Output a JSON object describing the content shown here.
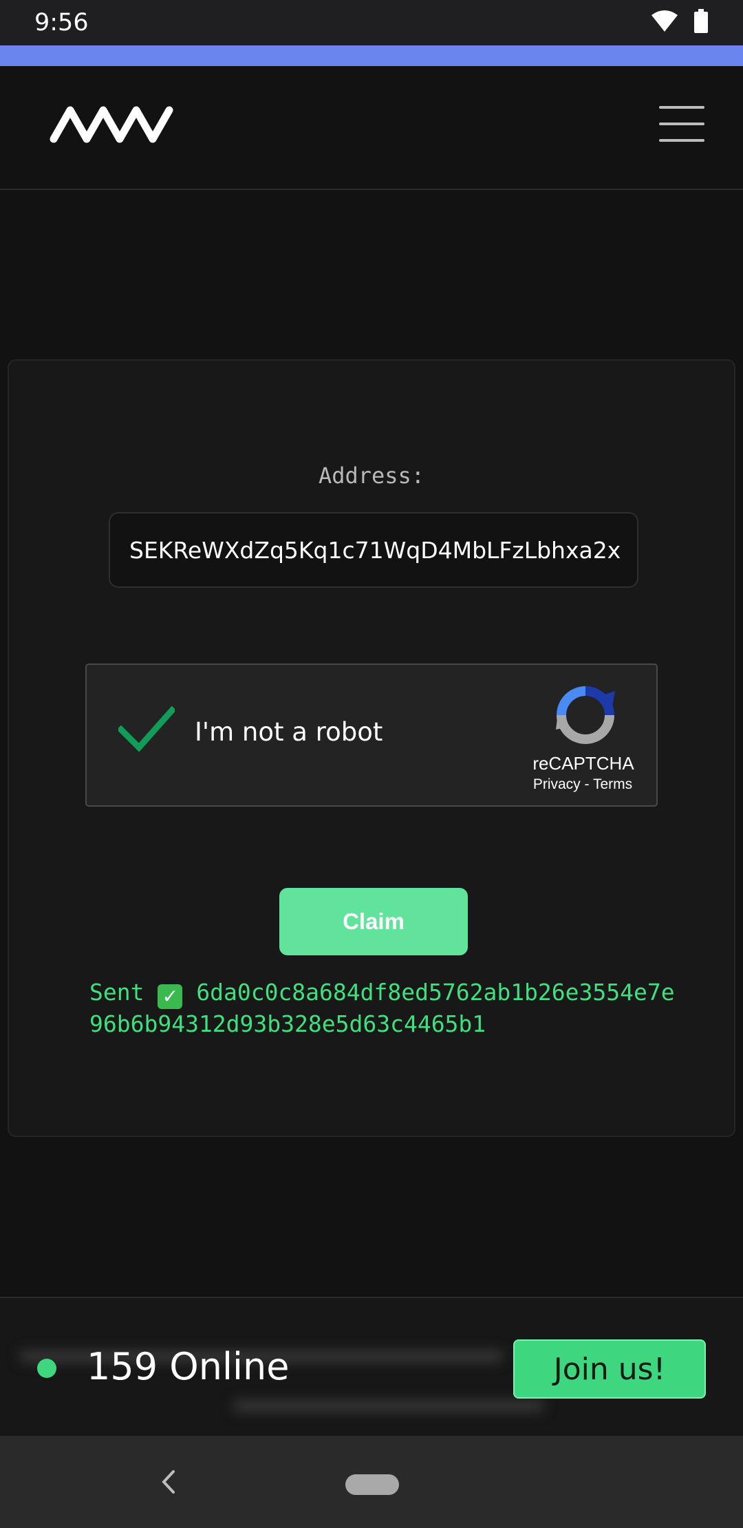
{
  "status_bar": {
    "time": "9:56",
    "icons": [
      "wifi-icon",
      "battery-icon"
    ]
  },
  "header": {
    "logo": "brand-logo",
    "menu_icon": "hamburger-menu-icon"
  },
  "form": {
    "address_label": "Address:",
    "address_value": "SEKReWXdZq5Kq1c71WqD4MbLFzLbhxa2x"
  },
  "recaptcha": {
    "label": "I'm not a robot",
    "brand": "reCAPTCHA",
    "privacy": "Privacy",
    "separator": "-",
    "terms": "Terms",
    "checked": true
  },
  "claim": {
    "label": "Claim"
  },
  "result": {
    "prefix": "Sent",
    "status_icon": "check-mark-button-emoji",
    "tx_hash": "6da0c0c8a684df8ed5762ab1b26e3554e7e96b6b94312d93b328e5d63c4465b1"
  },
  "footer": {
    "online_count": "159 Online",
    "join_label": "Join us!"
  },
  "colors": {
    "accent_strip": "#6a86ee",
    "claim": "#62e39c",
    "success_text": "#3ee17e",
    "online": "#3ed67e"
  }
}
